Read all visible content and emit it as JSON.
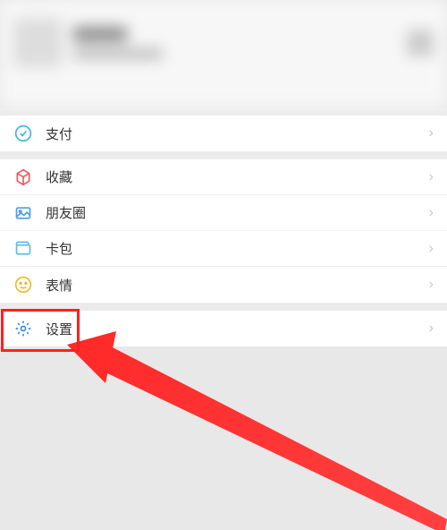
{
  "header": {
    "blurred": true
  },
  "groups": [
    {
      "items": [
        {
          "key": "pay",
          "label": "支付",
          "iconColor": "#3eb6e0"
        }
      ]
    },
    {
      "items": [
        {
          "key": "favorites",
          "label": "收藏",
          "iconColor": "#e85b5b"
        },
        {
          "key": "moments",
          "label": "朋友圈",
          "iconColor": "#4a9ee8"
        },
        {
          "key": "cards",
          "label": "卡包",
          "iconColor": "#5cbce8"
        },
        {
          "key": "stickers",
          "label": "表情",
          "iconColor": "#f0b830"
        }
      ]
    },
    {
      "items": [
        {
          "key": "settings",
          "label": "设置",
          "iconColor": "#3a8ee8"
        }
      ]
    }
  ],
  "highlight": {
    "target": "settings"
  }
}
